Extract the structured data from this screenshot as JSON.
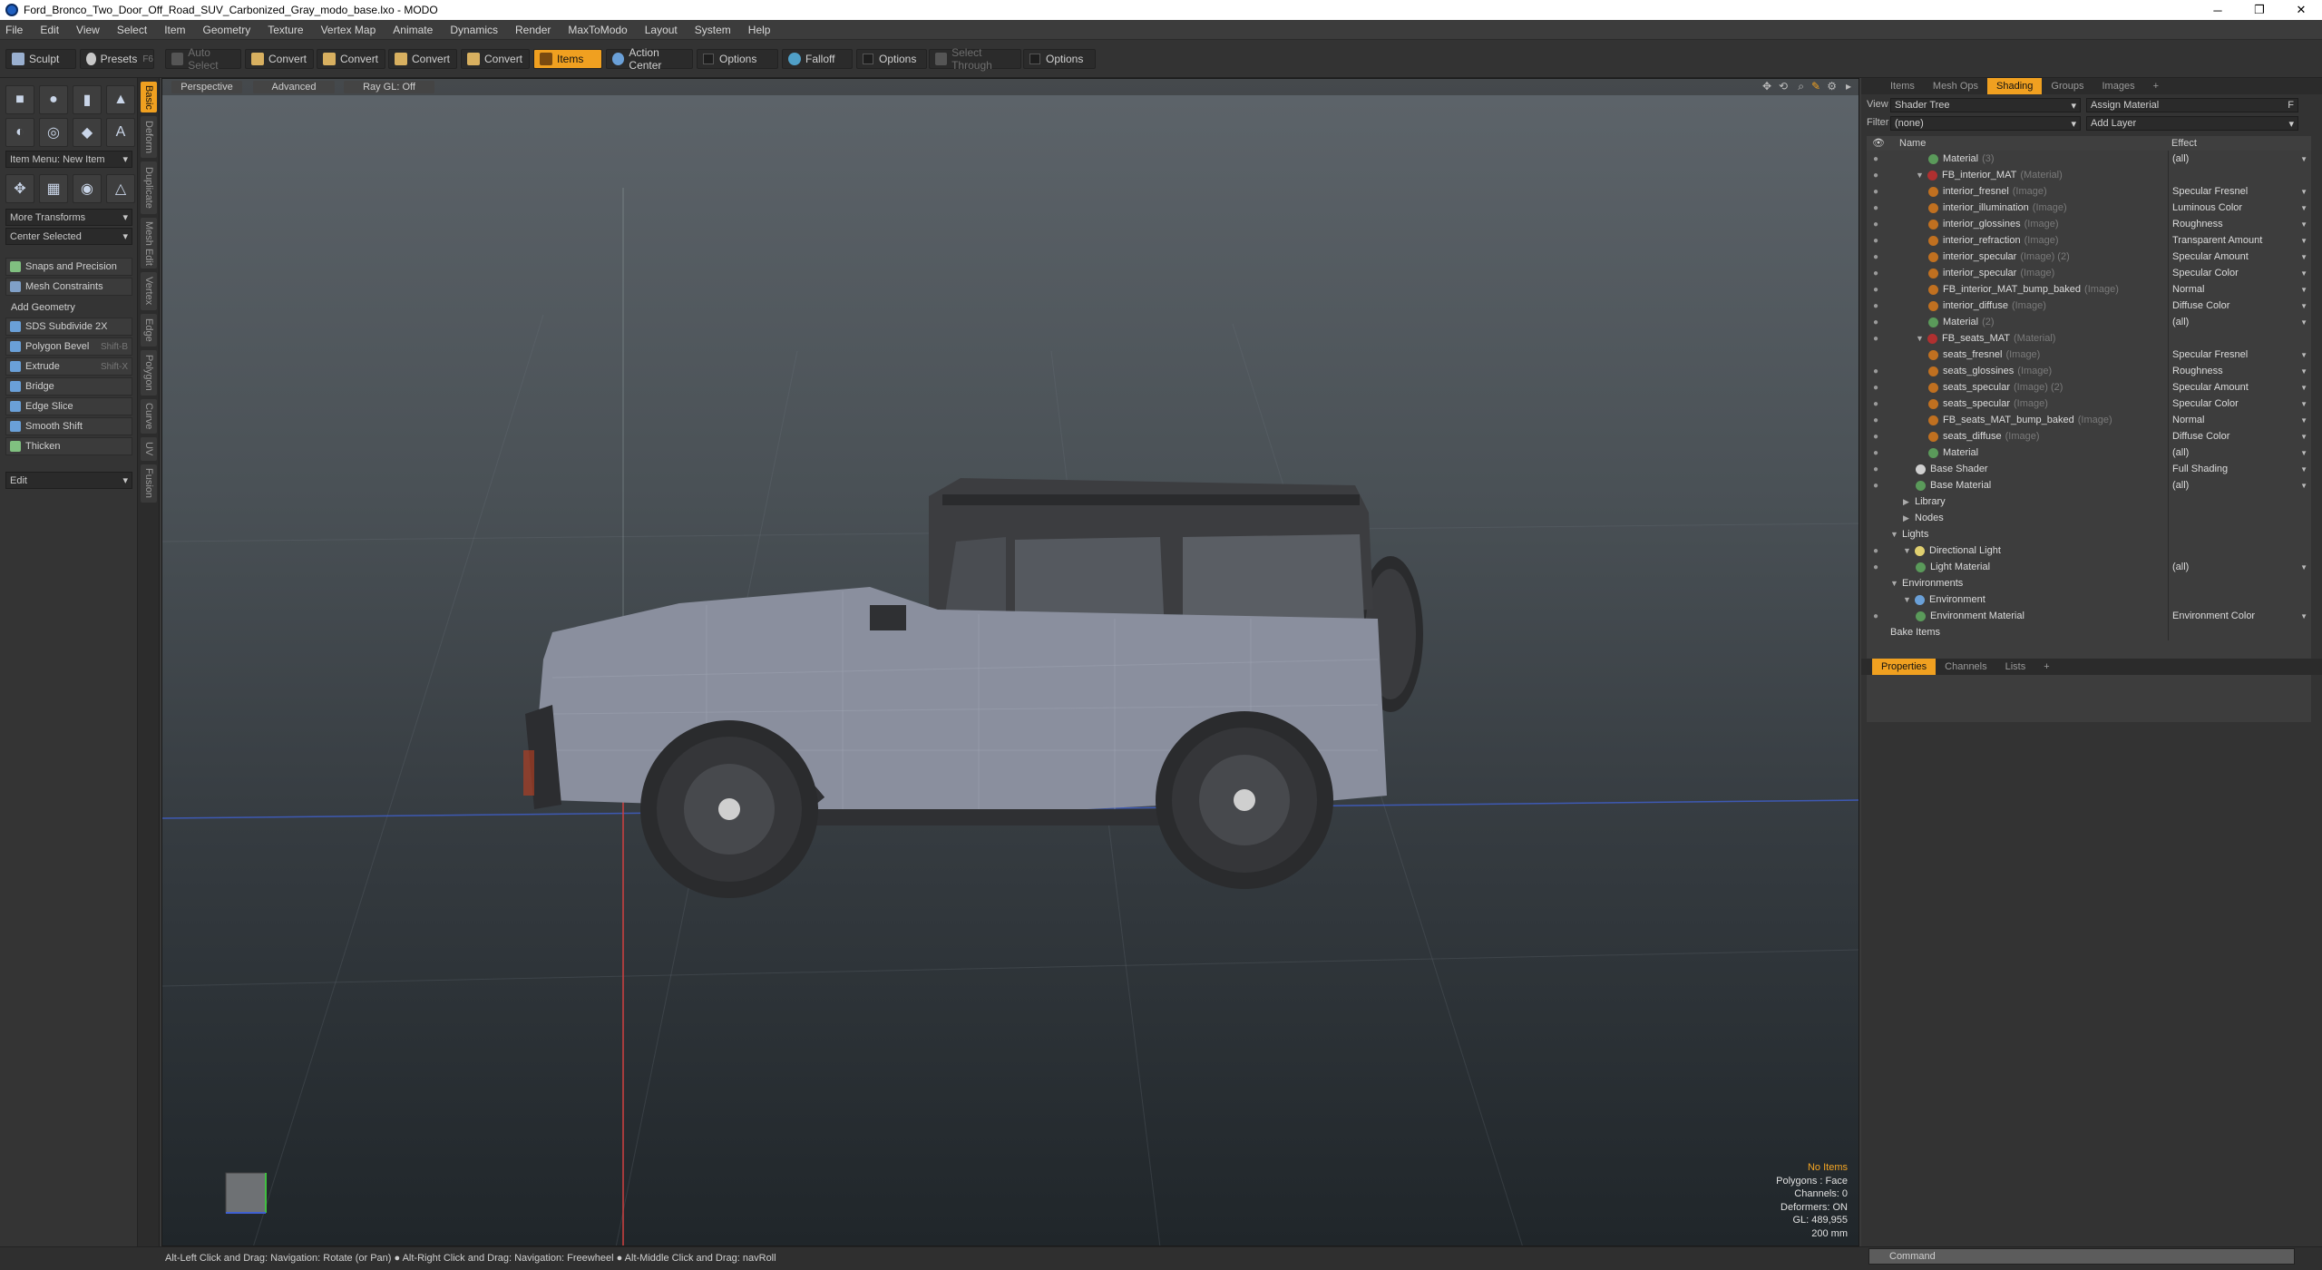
{
  "window": {
    "title": "Ford_Bronco_Two_Door_Off_Road_SUV_Carbonized_Gray_modo_base.lxo - MODO"
  },
  "menu": [
    "File",
    "Edit",
    "View",
    "Select",
    "Item",
    "Geometry",
    "Texture",
    "Vertex Map",
    "Animate",
    "Dynamics",
    "Render",
    "MaxToModo",
    "Layout",
    "System",
    "Help"
  ],
  "toolbar": {
    "sculpt": "Sculpt",
    "presets": "Presets",
    "presets_shortcut": "F6",
    "auto_select": "Auto Select",
    "convert1": "Convert",
    "convert2": "Convert",
    "convert3": "Convert",
    "convert4": "Convert",
    "items": "Items",
    "action_center": "Action Center",
    "options1": "Options",
    "falloff": "Falloff",
    "options2": "Options",
    "select_through": "Select Through",
    "options3": "Options"
  },
  "left_panel": {
    "item_menu": "Item Menu: New Item",
    "more_transforms": "More Transforms",
    "center_selected": "Center Selected",
    "snaps": "Snaps and Precision",
    "mesh_constraints": "Mesh Constraints",
    "add_geometry": "Add Geometry",
    "tools": [
      {
        "label": "SDS Subdivide 2X",
        "shortcut": ""
      },
      {
        "label": "Polygon Bevel",
        "shortcut": "Shift-B"
      },
      {
        "label": "Extrude",
        "shortcut": "Shift-X"
      },
      {
        "label": "Bridge",
        "shortcut": ""
      },
      {
        "label": "Edge Slice",
        "shortcut": ""
      },
      {
        "label": "Smooth Shift",
        "shortcut": ""
      },
      {
        "label": "Thicken",
        "shortcut": ""
      }
    ],
    "edit": "Edit",
    "vtabs": [
      "Basic",
      "Deform",
      "Duplicate",
      "Mesh Edit",
      "Vertex",
      "Edge",
      "Polygon",
      "Curve",
      "UV",
      "Fusion"
    ]
  },
  "viewport": {
    "perspective": "Perspective",
    "advanced": "Advanced",
    "raygl": "Ray GL: Off",
    "hud": {
      "no_items": "No Items",
      "polygons": "Polygons : Face",
      "channels": "Channels: 0",
      "deformers": "Deformers: ON",
      "gl": "GL: 489,955",
      "scale": "200 mm"
    }
  },
  "right_panel": {
    "tabs": [
      "Items",
      "Mesh Ops",
      "Shading",
      "Groups",
      "Images",
      "+"
    ],
    "active_tab": "Shading",
    "view_label": "View",
    "view_value": "Shader Tree",
    "assign_material": "Assign Material",
    "filter_label": "Filter",
    "filter_value": "(none)",
    "add_layer": "Add Layer",
    "col_name": "Name",
    "col_effect": "Effect",
    "rows": [
      {
        "name": "Material",
        "type": "(3)",
        "effect": "(all)",
        "indent": 3,
        "dot": "#5a9a5a",
        "eye": true
      },
      {
        "name": "FB_interior_MAT",
        "type": "(Material)",
        "effect": "",
        "indent": 2,
        "dot": "#b03030",
        "eye": true,
        "twisty": "▼"
      },
      {
        "name": "interior_fresnel",
        "type": "(Image)",
        "effect": "Specular Fresnel",
        "indent": 3,
        "dot": "#c07020",
        "eye": true
      },
      {
        "name": "interior_illumination",
        "type": "(Image)",
        "effect": "Luminous Color",
        "indent": 3,
        "dot": "#c07020",
        "eye": true
      },
      {
        "name": "interior_glossines",
        "type": "(Image)",
        "effect": "Roughness",
        "indent": 3,
        "dot": "#c07020",
        "eye": true
      },
      {
        "name": "interior_refraction",
        "type": "(Image)",
        "effect": "Transparent Amount",
        "indent": 3,
        "dot": "#c07020",
        "eye": true
      },
      {
        "name": "interior_specular",
        "type": "(Image) (2)",
        "effect": "Specular Amount",
        "indent": 3,
        "dot": "#c07020",
        "eye": true
      },
      {
        "name": "interior_specular",
        "type": "(Image)",
        "effect": "Specular Color",
        "indent": 3,
        "dot": "#c07020",
        "eye": true
      },
      {
        "name": "FB_interior_MAT_bump_baked",
        "type": "(Image)",
        "effect": "Normal",
        "indent": 3,
        "dot": "#c07020",
        "eye": true
      },
      {
        "name": "interior_diffuse",
        "type": "(Image)",
        "effect": "Diffuse Color",
        "indent": 3,
        "dot": "#c07020",
        "eye": true
      },
      {
        "name": "Material",
        "type": "(2)",
        "effect": "(all)",
        "indent": 3,
        "dot": "#5a9a5a",
        "eye": true
      },
      {
        "name": "FB_seats_MAT",
        "type": "(Material)",
        "effect": "",
        "indent": 2,
        "dot": "#b03030",
        "eye": true,
        "twisty": "▼"
      },
      {
        "name": "seats_fresnel",
        "type": "(Image)",
        "effect": "Specular Fresnel",
        "indent": 3,
        "dot": "#c07020",
        "eye": false
      },
      {
        "name": "seats_glossines",
        "type": "(Image)",
        "effect": "Roughness",
        "indent": 3,
        "dot": "#c07020",
        "eye": true
      },
      {
        "name": "seats_specular",
        "type": "(Image) (2)",
        "effect": "Specular Amount",
        "indent": 3,
        "dot": "#c07020",
        "eye": true
      },
      {
        "name": "seats_specular",
        "type": "(Image)",
        "effect": "Specular Color",
        "indent": 3,
        "dot": "#c07020",
        "eye": true
      },
      {
        "name": "FB_seats_MAT_bump_baked",
        "type": "(Image)",
        "effect": "Normal",
        "indent": 3,
        "dot": "#c07020",
        "eye": true
      },
      {
        "name": "seats_diffuse",
        "type": "(Image)",
        "effect": "Diffuse Color",
        "indent": 3,
        "dot": "#c07020",
        "eye": true
      },
      {
        "name": "Material",
        "type": "",
        "effect": "(all)",
        "indent": 3,
        "dot": "#5a9a5a",
        "eye": true
      },
      {
        "name": "Base Shader",
        "type": "",
        "effect": "Full Shading",
        "indent": 2,
        "dot": "#d0d0d0",
        "eye": true
      },
      {
        "name": "Base Material",
        "type": "",
        "effect": "(all)",
        "indent": 2,
        "dot": "#5a9a5a",
        "eye": true
      },
      {
        "name": "Library",
        "type": "",
        "effect": "",
        "indent": 1,
        "dot": "",
        "eye": false,
        "twisty": "▶"
      },
      {
        "name": "Nodes",
        "type": "",
        "effect": "",
        "indent": 1,
        "dot": "",
        "eye": false,
        "twisty": "▶"
      },
      {
        "name": "Lights",
        "type": "",
        "effect": "",
        "indent": 0,
        "dot": "",
        "eye": false,
        "twisty": "▼"
      },
      {
        "name": "Directional Light",
        "type": "",
        "effect": "",
        "indent": 1,
        "dot": "#e0d070",
        "eye": true,
        "twisty": "▼"
      },
      {
        "name": "Light Material",
        "type": "",
        "effect": "(all)",
        "indent": 2,
        "dot": "#5a9a5a",
        "eye": true
      },
      {
        "name": "Environments",
        "type": "",
        "effect": "",
        "indent": 0,
        "dot": "",
        "eye": false,
        "twisty": "▼"
      },
      {
        "name": "Environment",
        "type": "",
        "effect": "",
        "indent": 1,
        "dot": "#6aa0d8",
        "eye": false,
        "twisty": "▼"
      },
      {
        "name": "Environment Material",
        "type": "",
        "effect": "Environment Color",
        "indent": 2,
        "dot": "#5a9a5a",
        "eye": true
      },
      {
        "name": "Bake Items",
        "type": "",
        "effect": "",
        "indent": 0,
        "dot": "",
        "eye": false
      }
    ],
    "bottom_tabs": [
      "Properties",
      "Channels",
      "Lists",
      "+"
    ],
    "command_placeholder": "Command"
  },
  "status": {
    "text": "Alt-Left Click and Drag: Navigation: Rotate (or Pan) ● Alt-Right Click and Drag: Navigation: Freewheel ● Alt-Middle Click and Drag: navRoll"
  },
  "colors": {
    "accent": "#f0a020",
    "car_body": "#8a8f9e",
    "car_roof": "#3a3c3f"
  }
}
